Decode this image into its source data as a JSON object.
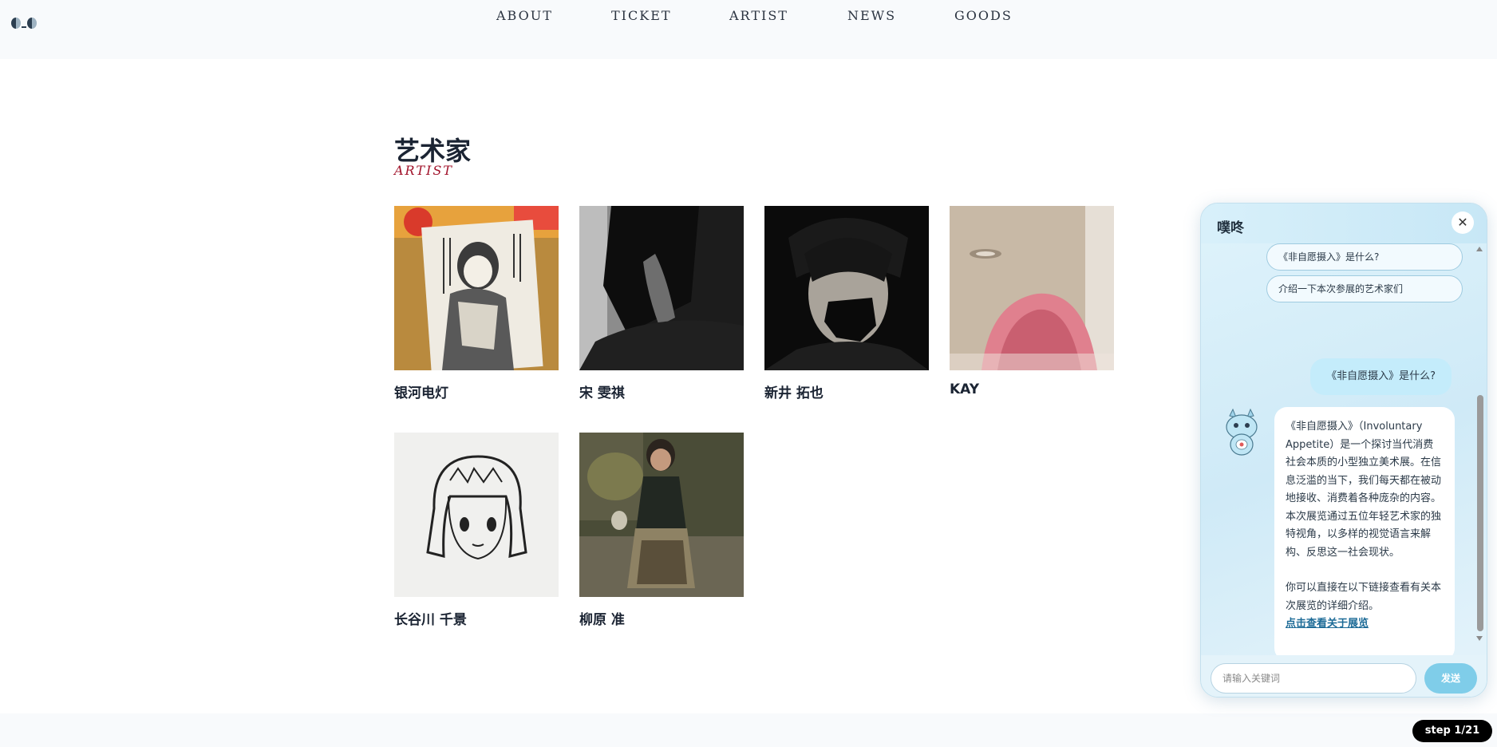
{
  "header": {
    "nav": [
      "ABOUT",
      "TICKET",
      "ARTIST",
      "NEWS",
      "GOODS"
    ]
  },
  "section": {
    "title": "艺术家",
    "subtitle": "ARTIST"
  },
  "artists": [
    "银河电灯",
    "宋 雯祺",
    "新井 拓也",
    "KAY",
    "长谷川 千景",
    "柳原 准"
  ],
  "chat": {
    "title": "噗咚",
    "close": "✕",
    "suggestions": [
      "《非自愿摄入》是什么?",
      "介绍一下本次参展的艺术家们"
    ],
    "user_message": "《非自愿摄入》是什么?",
    "bot_message_p1": "《非自愿摄入》（Involuntary Appetite）是一个探讨当代消费社会本质的小型独立美术展。在信息泛滥的当下，我们每天都在被动地接收、消费着各种庞杂的内容。本次展览通过五位年轻艺术家的独特视角，以多样的视觉语言来解构、反思这一社会现状。",
    "bot_message_p2": "你可以直接在以下链接查看有关本次展览的详细介绍。",
    "bot_link": "点击查看关于展览",
    "input_placeholder": "请输入关键词",
    "send_label": "发送"
  },
  "step_badge": "step 1/21"
}
